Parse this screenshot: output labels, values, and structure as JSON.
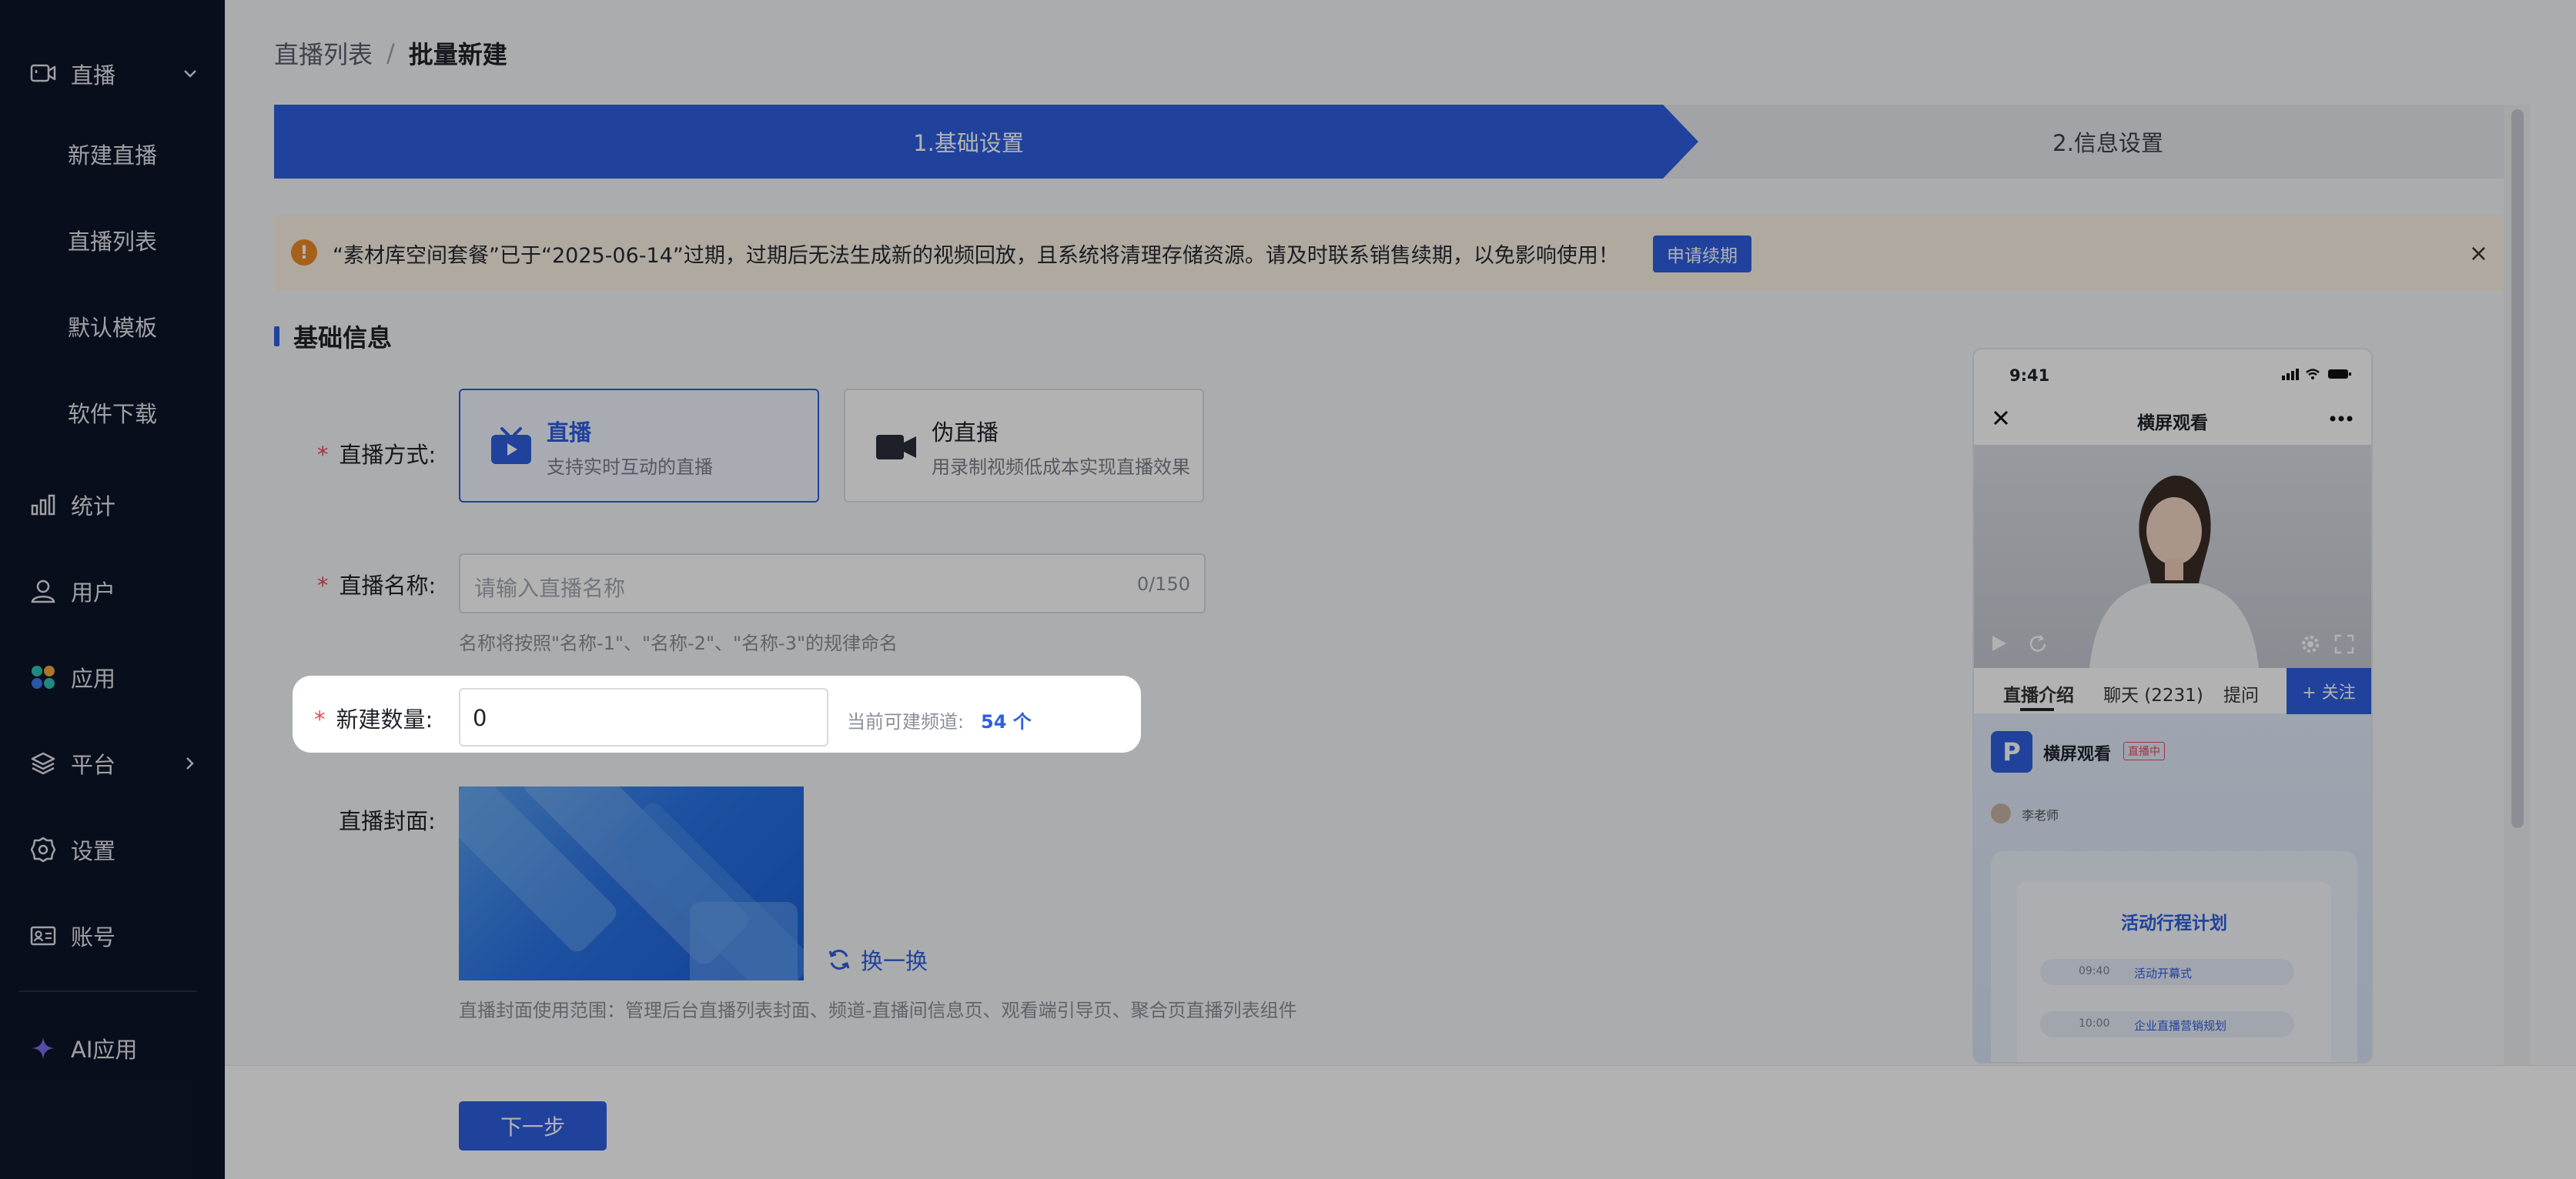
{
  "sidebar": {
    "live": "直播",
    "sub_items": [
      "新建直播",
      "直播列表",
      "默认模板",
      "软件下载"
    ],
    "stats": "统计",
    "users": "用户",
    "apps": "应用",
    "platform": "平台",
    "settings": "设置",
    "account": "账号",
    "ai_apps": "AI应用"
  },
  "breadcrumb": {
    "parent": "直播列表",
    "separator": "/",
    "current": "批量新建"
  },
  "steps": [
    "1.基础设置",
    "2.信息设置"
  ],
  "alert": {
    "message": "“素材库空间套餐”已于“2025-06-14”过期，过期后无法生成新的视频回放，且系统将清理存储资源。请及时联系销售续期，以免影响使用！",
    "action": "申请续期",
    "close": "×"
  },
  "section": {
    "title": "基础信息"
  },
  "form": {
    "mode_label": "直播方式:",
    "modes": [
      {
        "title": "直播",
        "desc": "支持实时互动的直播"
      },
      {
        "title": "伪直播",
        "desc": "用录制视频低成本实现直播效果"
      }
    ],
    "name_label": "直播名称:",
    "name_placeholder": "请输入直播名称",
    "name_counter": "0/150",
    "name_hint": "名称将按照\"名称-1\"、\"名称-2\"、\"名称-3\"的规律命名",
    "count_label": "新建数量:",
    "count_value": "0",
    "available_label": "当前可建频道:",
    "available_value": "54 个",
    "cover_label": "直播封面:",
    "swap_label": "换一换",
    "cover_hint": "直播封面使用范围：管理后台直播列表封面、频道-直播间信息页、观看端引导页、聚合页直播列表组件",
    "required_mark": "*"
  },
  "phone": {
    "time": "9:41",
    "title": "横屏观看",
    "tabs": [
      "直播介绍",
      "聊天 (2231)",
      "提问"
    ],
    "follow": "+ 关注",
    "channel_name": "横屏观看",
    "live_badge": "直播中",
    "teacher": "李老师",
    "schedule_title": "活动行程计划",
    "schedule": [
      {
        "time": "09:40",
        "item": "活动开幕式"
      },
      {
        "time": "10:00",
        "item": "企业直播营销规划"
      }
    ]
  },
  "footer": {
    "next": "下一步"
  },
  "colors": {
    "primary": "#2f5fe0",
    "sidebar_bg": "#0e1529",
    "warning": "#f08a24",
    "danger": "#e34d59"
  }
}
